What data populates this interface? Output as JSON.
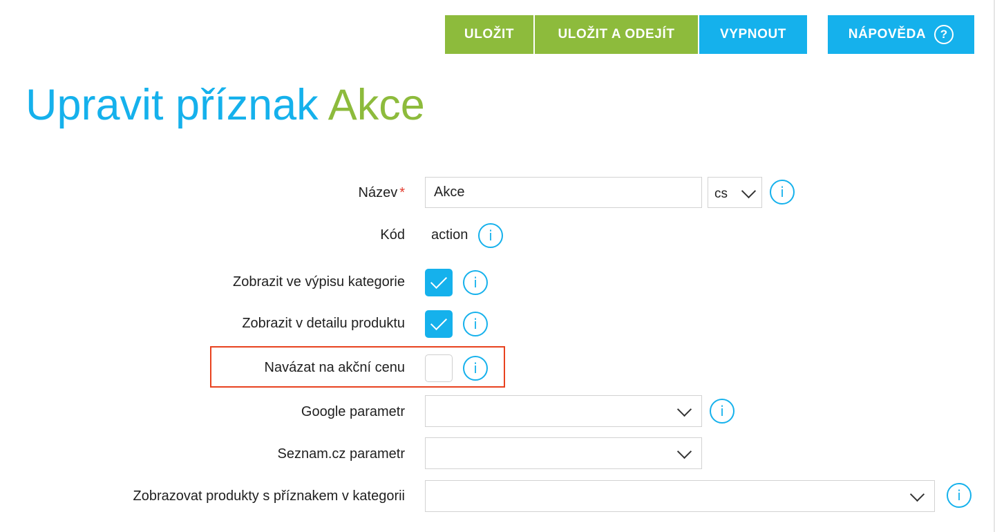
{
  "toolbar": {
    "save_label": "ULOŽIT",
    "save_exit_label": "ULOŽIT A ODEJÍT",
    "disable_label": "VYPNOUT",
    "help_label": "NÁPOVĚDA",
    "help_icon_glyph": "?"
  },
  "page_title": {
    "prefix": "Upravit příznak",
    "name": "Akce"
  },
  "form": {
    "name": {
      "label": "Název",
      "required_mark": "*",
      "value": "Akce",
      "language": "cs"
    },
    "code": {
      "label": "Kód",
      "value": "action"
    },
    "show_in_category": {
      "label": "Zobrazit ve výpisu kategorie",
      "checked": true
    },
    "show_in_detail": {
      "label": "Zobrazit v detailu produktu",
      "checked": true
    },
    "bind_to_sale_price": {
      "label": "Navázat na akční cenu",
      "checked": false
    },
    "google_param": {
      "label": "Google parametr",
      "value": ""
    },
    "seznam_param": {
      "label": "Seznam.cz parametr",
      "value": ""
    },
    "show_products_in_category": {
      "label": "Zobrazovat produkty s příznakem v kategorii",
      "value": ""
    }
  },
  "info_glyph": "i",
  "colors": {
    "green": "#8dbb3c",
    "blue": "#15b1ec",
    "highlight": "#e8411e",
    "required": "#e33b2d"
  },
  "icons": [
    "help-icon",
    "info-icon",
    "chevron-down-icon",
    "checkmark-icon"
  ]
}
